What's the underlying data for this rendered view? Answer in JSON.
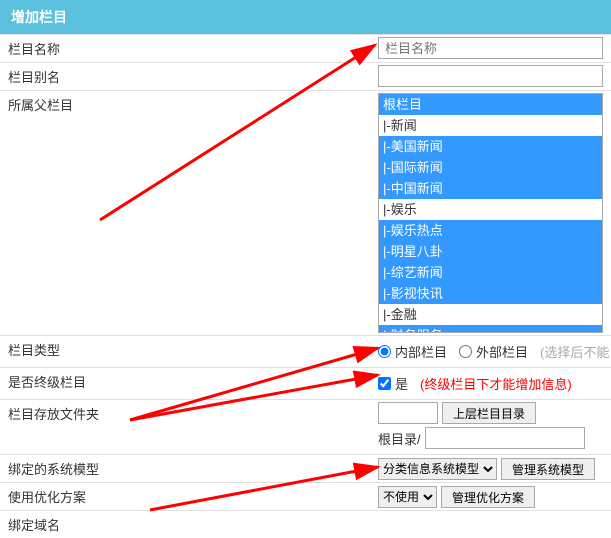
{
  "header": {
    "title": "增加栏目"
  },
  "labels": {
    "name": "栏目名称",
    "alias": "栏目别名",
    "parent": "所属父栏目",
    "type": "栏目类型",
    "terminal": "是否终级栏目",
    "folder": "栏目存放文件夹",
    "model": "绑定的系统模型",
    "seo": "使用优化方案",
    "domain": "绑定域名"
  },
  "fields": {
    "name_placeholder": "栏目名称",
    "alias_value": "",
    "type_internal": "内部栏目",
    "type_external": "外部栏目",
    "type_hint": "(选择后不能",
    "terminal_yes": "是",
    "terminal_hint": "(终级栏目下才能增加信息)",
    "folder_parent_btn": "上层栏目目录",
    "folder_root_label": "根目录/",
    "folder_root_value": "",
    "model_select": "分类信息系统模型",
    "model_manage_btn": "管理系统模型",
    "seo_select": "不使用",
    "seo_manage_btn": "管理优化方案"
  },
  "tree": {
    "items": [
      {
        "text": "根栏目",
        "selected": true,
        "indent": 0
      },
      {
        "text": "|-新闻",
        "selected": false,
        "indent": 0
      },
      {
        "text": "  |-美国新闻",
        "selected": true,
        "indent": 1
      },
      {
        "text": "  |-国际新闻",
        "selected": true,
        "indent": 1
      },
      {
        "text": "  |-中国新闻",
        "selected": true,
        "indent": 1
      },
      {
        "text": "|-娱乐",
        "selected": false,
        "indent": 0
      },
      {
        "text": "  |-娱乐热点",
        "selected": true,
        "indent": 1
      },
      {
        "text": "  |-明星八卦",
        "selected": true,
        "indent": 1
      },
      {
        "text": "  |-综艺新闻",
        "selected": true,
        "indent": 1
      },
      {
        "text": "  |-影视快讯",
        "selected": true,
        "indent": 1
      },
      {
        "text": "|-金融",
        "selected": false,
        "indent": 0
      },
      {
        "text": "  |-财务服务",
        "selected": true,
        "indent": 1
      }
    ]
  }
}
